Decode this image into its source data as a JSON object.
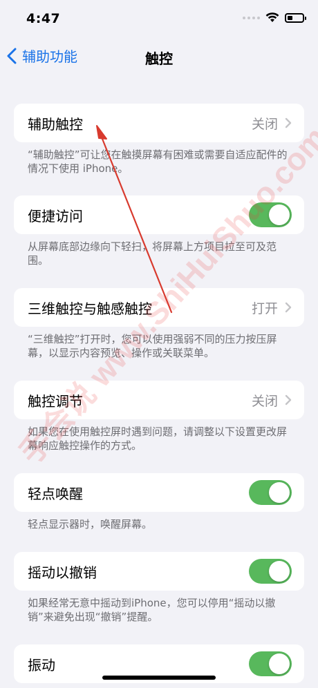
{
  "status": {
    "time": "4:47"
  },
  "nav": {
    "back_label": "辅助功能",
    "title": "触控"
  },
  "cells": [
    {
      "label": "辅助触控",
      "value": "关闭",
      "type": "link",
      "footer": "“辅助触控”可让您在触摸屏幕有困难或需要自适应配件的情况下使用 iPhone。"
    },
    {
      "label": "便捷访问",
      "type": "toggle",
      "on": true,
      "footer": "从屏幕底部边缘向下轻扫，将屏幕上方项目拉至可及范围。"
    },
    {
      "label": "三维触控与触感触控",
      "value": "打开",
      "type": "link",
      "footer": "“三维触控”打开时，您可以使用强弱不同的压力按压屏幕，以显示内容预览、操作或关联菜单。"
    },
    {
      "label": "触控调节",
      "value": "关闭",
      "type": "link",
      "footer": "如果您在使用触控屏时遇到问题，请调整以下设置更改屏幕响应触控操作的方式。"
    },
    {
      "label": "轻点唤醒",
      "type": "toggle",
      "on": true,
      "footer": "轻点显示器时，唤醒屏幕。"
    },
    {
      "label": "摇动以撤销",
      "type": "toggle",
      "on": true,
      "footer": "如果经常无意中摇动到iPhone，您可以停用“摇动以撤销”来避免出现“撤销”提醒。"
    },
    {
      "label": "振动",
      "type": "toggle",
      "on": true
    }
  ],
  "watermark": "手会说 www.ShiHuiShuo.com",
  "colors": {
    "accent": "#1a73e8",
    "toggle_on": "#58b85c",
    "annotation": "#d83a2e",
    "watermark": "#eb3c3c"
  },
  "icons": {
    "back": "chevron-left-icon",
    "disclosure": "chevron-right-icon",
    "wifi": "wifi-icon",
    "battery": "battery-icon",
    "signal": "cellular-signal-icon"
  },
  "battery_level": 0.35
}
